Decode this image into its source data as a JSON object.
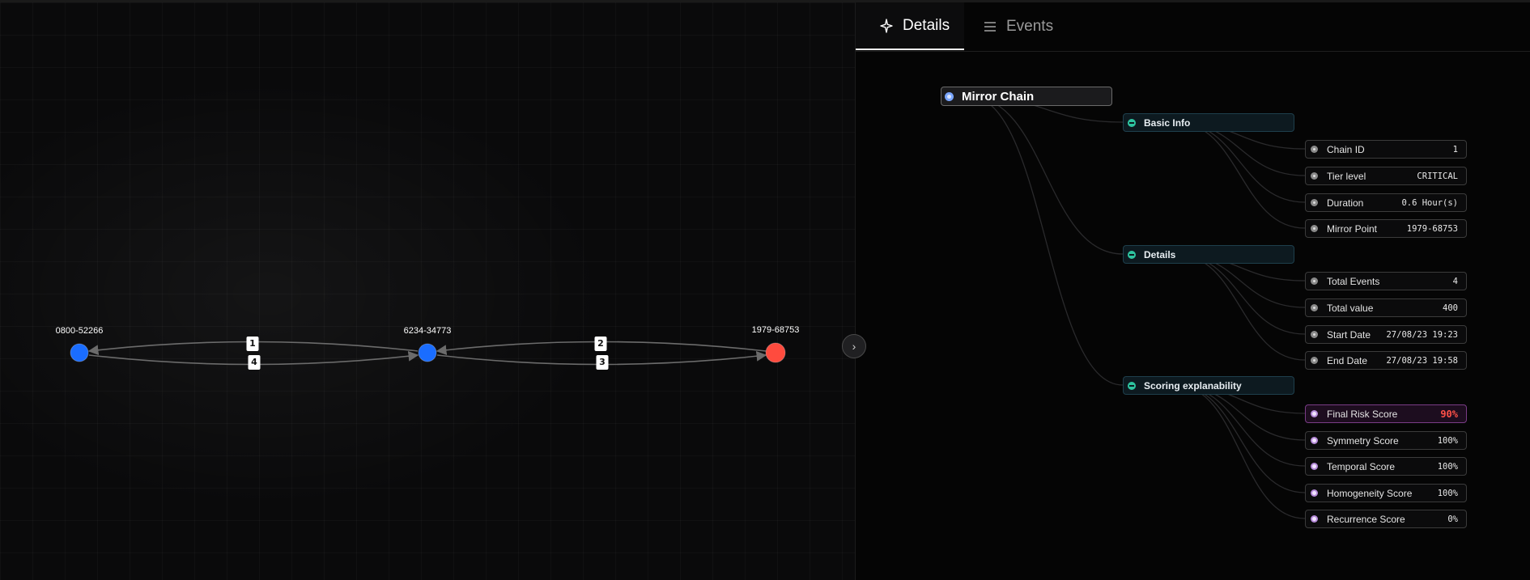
{
  "graph": {
    "nodes": [
      {
        "id": "0800-52266",
        "label": "0800-52266",
        "color": "#1a6dff"
      },
      {
        "id": "6234-34773",
        "label": "6234-34773",
        "color": "#1a6dff"
      },
      {
        "id": "1979-68753",
        "label": "1979-68753",
        "color": "#ff4b3e"
      }
    ],
    "edges": [
      {
        "label": "1"
      },
      {
        "label": "4"
      },
      {
        "label": "2"
      },
      {
        "label": "3"
      }
    ],
    "collapse_icon": "chevron-right-icon"
  },
  "tabs": {
    "details": {
      "label": "Details",
      "icon": "sparkle-icon"
    },
    "events": {
      "label": "Events",
      "icon": "list-icon"
    }
  },
  "tree": {
    "root": "Mirror Chain",
    "groups": [
      {
        "title": "Basic Info",
        "items": [
          {
            "label": "Chain ID",
            "value": "1"
          },
          {
            "label": "Tier level",
            "value": "CRITICAL"
          },
          {
            "label": "Duration",
            "value": "0.6 Hour(s)"
          },
          {
            "label": "Mirror Point",
            "value": "1979-68753"
          }
        ]
      },
      {
        "title": "Details",
        "items": [
          {
            "label": "Total Events",
            "value": "4"
          },
          {
            "label": "Total value",
            "value": "400"
          },
          {
            "label": "Start Date",
            "value": "27/08/23 19:23"
          },
          {
            "label": "End Date",
            "value": "27/08/23 19:58"
          }
        ]
      },
      {
        "title": "Scoring explanability",
        "items": [
          {
            "label": "Final Risk Score",
            "value": "90%"
          },
          {
            "label": "Symmetry Score",
            "value": "100%"
          },
          {
            "label": "Temporal Score",
            "value": "100%"
          },
          {
            "label": "Homogeneity Score",
            "value": "100%"
          },
          {
            "label": "Recurrence Score",
            "value": "0%"
          }
        ]
      }
    ],
    "accent_colors": {
      "risk": "#ff5148",
      "group": "#2ec4a0",
      "node": "#1a6dff"
    }
  }
}
